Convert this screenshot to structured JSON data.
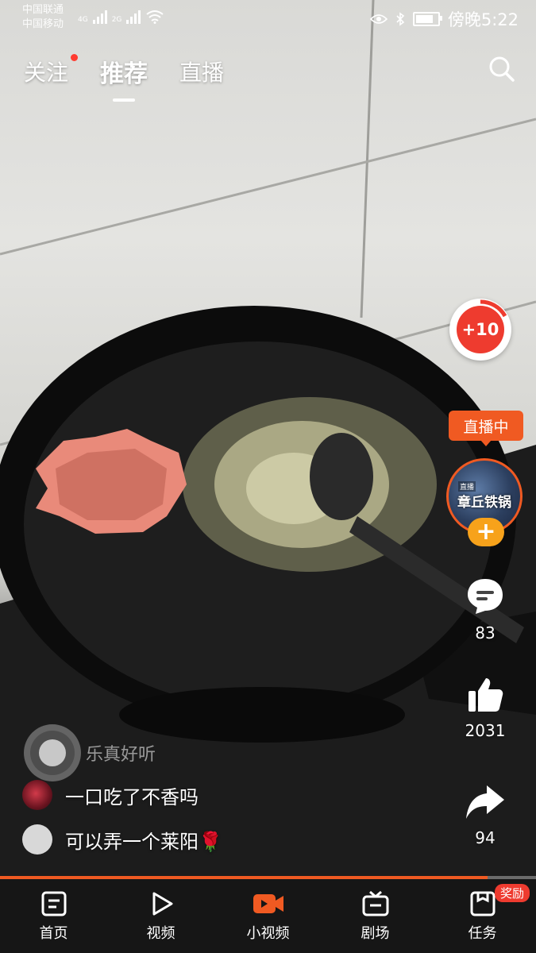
{
  "status_bar": {
    "carrier_1": "中国联通",
    "carrier_2": "中国移动",
    "network_1": "4G",
    "network_2": "2G",
    "time": "傍晚5:22"
  },
  "top_tabs": [
    {
      "label": "关注",
      "has_dot": true
    },
    {
      "label": "推荐",
      "active": true
    },
    {
      "label": "直播"
    }
  ],
  "icons": {
    "search": "search-icon",
    "comment": "comment-icon",
    "like": "thumbs-up-icon",
    "share": "share-icon"
  },
  "right_rail": {
    "timer_label": "+10",
    "live_tag": "直播中",
    "live_avatar_name": "章丘铁锅",
    "follow_label": "+",
    "comment_count": "83",
    "like_count": "2031",
    "share_count": "94"
  },
  "overlay": {
    "author_name": "乐真好听",
    "comments": [
      {
        "text": "一口吃了不香吗"
      },
      {
        "text": "可以弄一个莱阳🌹"
      }
    ]
  },
  "progress": 0.91,
  "bottom_nav": {
    "items": [
      {
        "label": "首页"
      },
      {
        "label": "视频"
      },
      {
        "label": "小视频",
        "active": true
      },
      {
        "label": "剧场"
      },
      {
        "label": "任务",
        "badge": "奖励"
      }
    ]
  },
  "colors": {
    "accent": "#f05a22",
    "timer_red": "#ee3b2f",
    "follow_orange": "#f7a21b",
    "nav_bg": "#161616"
  }
}
